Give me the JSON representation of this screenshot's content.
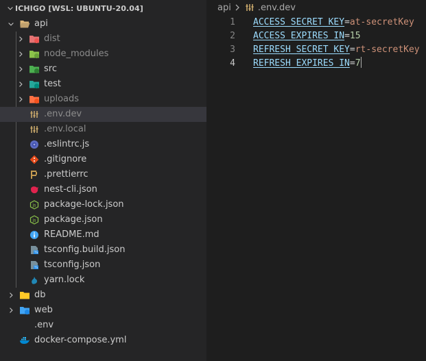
{
  "explorer": {
    "title": "ICHIGO [WSL: UBUNTU-20.04]",
    "tree": [
      {
        "label": "api",
        "depth": 0,
        "kind": "folder",
        "expanded": true,
        "icon": "folder-open-icon"
      },
      {
        "label": "dist",
        "depth": 1,
        "kind": "folder",
        "expanded": false,
        "icon": "folder-dist-icon",
        "dim": true
      },
      {
        "label": "node_modules",
        "depth": 1,
        "kind": "folder",
        "expanded": false,
        "icon": "folder-node-icon",
        "dim": true
      },
      {
        "label": "src",
        "depth": 1,
        "kind": "folder",
        "expanded": false,
        "icon": "folder-src-icon"
      },
      {
        "label": "test",
        "depth": 1,
        "kind": "folder",
        "expanded": false,
        "icon": "folder-test-icon"
      },
      {
        "label": "uploads",
        "depth": 1,
        "kind": "folder",
        "expanded": false,
        "icon": "folder-uploads-icon",
        "dim": true
      },
      {
        "label": ".env.dev",
        "depth": 1,
        "kind": "file",
        "icon": "env-file-icon",
        "selected": true,
        "dim": true
      },
      {
        "label": ".env.local",
        "depth": 1,
        "kind": "file",
        "icon": "env-file-icon",
        "dim": true
      },
      {
        "label": ".eslintrc.js",
        "depth": 1,
        "kind": "file",
        "icon": "eslint-icon"
      },
      {
        "label": ".gitignore",
        "depth": 1,
        "kind": "file",
        "icon": "git-icon"
      },
      {
        "label": ".prettierrc",
        "depth": 1,
        "kind": "file",
        "icon": "prettier-icon"
      },
      {
        "label": "nest-cli.json",
        "depth": 1,
        "kind": "file",
        "icon": "nestjs-icon"
      },
      {
        "label": "package-lock.json",
        "depth": 1,
        "kind": "file",
        "icon": "nodejs-icon"
      },
      {
        "label": "package.json",
        "depth": 1,
        "kind": "file",
        "icon": "nodejs-icon"
      },
      {
        "label": "README.md",
        "depth": 1,
        "kind": "file",
        "icon": "info-icon"
      },
      {
        "label": "tsconfig.build.json",
        "depth": 1,
        "kind": "file",
        "icon": "tsconfig-icon"
      },
      {
        "label": "tsconfig.json",
        "depth": 1,
        "kind": "file",
        "icon": "tsconfig-icon"
      },
      {
        "label": "yarn.lock",
        "depth": 1,
        "kind": "file",
        "icon": "yarn-icon"
      },
      {
        "label": "db",
        "depth": 0,
        "kind": "folder",
        "expanded": false,
        "icon": "folder-yellow-icon"
      },
      {
        "label": "web",
        "depth": 0,
        "kind": "folder",
        "expanded": false,
        "icon": "folder-web-icon"
      },
      {
        "label": ".env",
        "depth": 0,
        "kind": "file",
        "icon": "none"
      },
      {
        "label": "docker-compose.yml",
        "depth": 0,
        "kind": "file",
        "icon": "docker-icon"
      }
    ]
  },
  "editor": {
    "breadcrumb": {
      "folder": "api",
      "file": ".env.dev"
    },
    "lines": [
      {
        "number": "1",
        "key": "ACCESS_SECRET_KEY",
        "eq": "=",
        "value": "at-secretKey",
        "value_type": "string"
      },
      {
        "number": "2",
        "key": "ACCESS_EXPIRES_IN",
        "eq": "=",
        "value": "15",
        "value_type": "number"
      },
      {
        "number": "3",
        "key": "REFRESH_SECRET_KEY",
        "eq": "=",
        "value": "rt-secretKey",
        "value_type": "string"
      },
      {
        "number": "4",
        "key": "REFRESH_EXPIRES_IN",
        "eq": "=",
        "value": "7",
        "value_type": "number",
        "active": true
      }
    ]
  },
  "colors": {
    "sidebar_bg": "#252526",
    "editor_bg": "#1e1e1e",
    "selected_row": "#37373d",
    "key": "#9cdcfe",
    "string": "#ce9178",
    "number": "#b5cea8"
  }
}
